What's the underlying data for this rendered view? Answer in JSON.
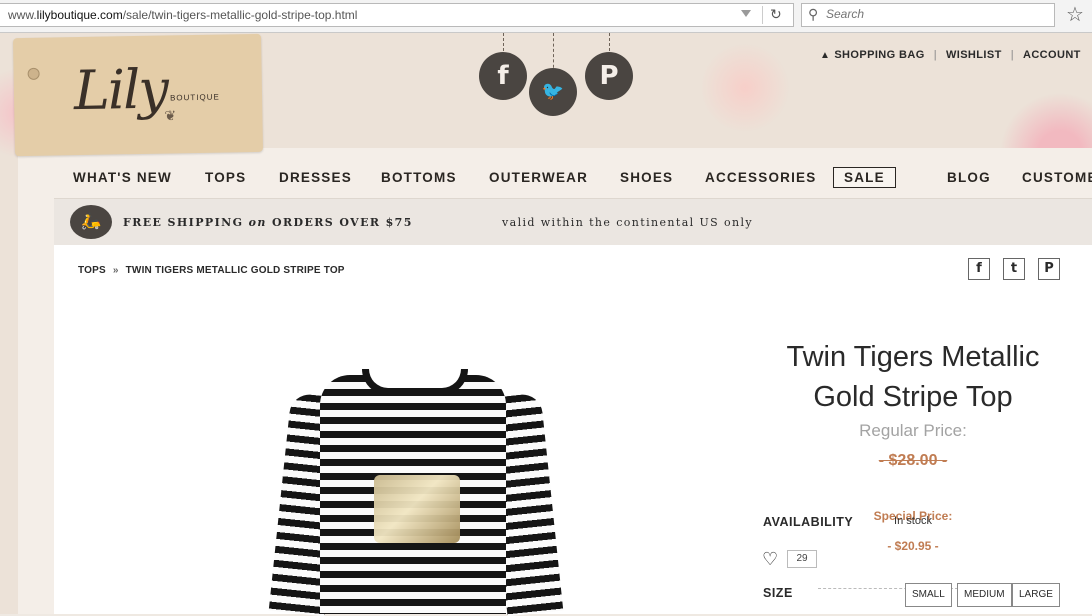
{
  "browser": {
    "url_prefix": "www.",
    "url_domain": "lilyboutique.com",
    "url_path": "/sale/twin-tigers-metallic-gold-stripe-top.html",
    "search_placeholder": "Search"
  },
  "header": {
    "logo_text": "Lily",
    "logo_subtext": "BOUTIQUE",
    "social_icons": [
      "facebook-icon",
      "twitter-bird-icon",
      "pinterest-icon"
    ],
    "social_glyphs": {
      "facebook": "f",
      "bird": "🐦",
      "pinterest": "P"
    },
    "account_links": {
      "shopping_bag": "SHOPPING BAG",
      "wishlist": "WISHLIST",
      "account": "ACCOUNT"
    }
  },
  "nav": {
    "items": [
      "WHAT'S NEW",
      "TOPS",
      "DRESSES",
      "BOTTOMS",
      "OUTERWEAR",
      "SHOES",
      "ACCESSORIES",
      "SALE",
      "BLOG",
      "CUSTOMER"
    ],
    "active": "SALE"
  },
  "shipping": {
    "text_a": "FREE SHIPPING ",
    "text_on": "on",
    "text_b": " ORDERS OVER $75",
    "note": "valid within the continental US only"
  },
  "breadcrumb": {
    "items": [
      "TOPS",
      "TWIN TIGERS METALLIC GOLD STRIPE TOP"
    ],
    "separator": "»"
  },
  "share": {
    "icons": [
      "facebook-share-icon",
      "twitter-share-icon",
      "pinterest-share-icon"
    ],
    "glyphs": [
      "f",
      "t",
      "P"
    ]
  },
  "product": {
    "title": "Twin Tigers Metallic Gold Stripe Top",
    "regular_price_label": "Regular Price:",
    "regular_price": "- $28.00 -",
    "special_price_label": "Special Price:",
    "special_price": "- $20.95 -",
    "availability_label": "AVAILABILITY",
    "availability_value": "In stock",
    "like_count": "29",
    "size_label": "SIZE",
    "sizes": [
      "SMALL",
      "MEDIUM",
      "LARGE"
    ]
  },
  "colors": {
    "price_accent": "#c07c52",
    "dark_circle": "#4a4541"
  }
}
